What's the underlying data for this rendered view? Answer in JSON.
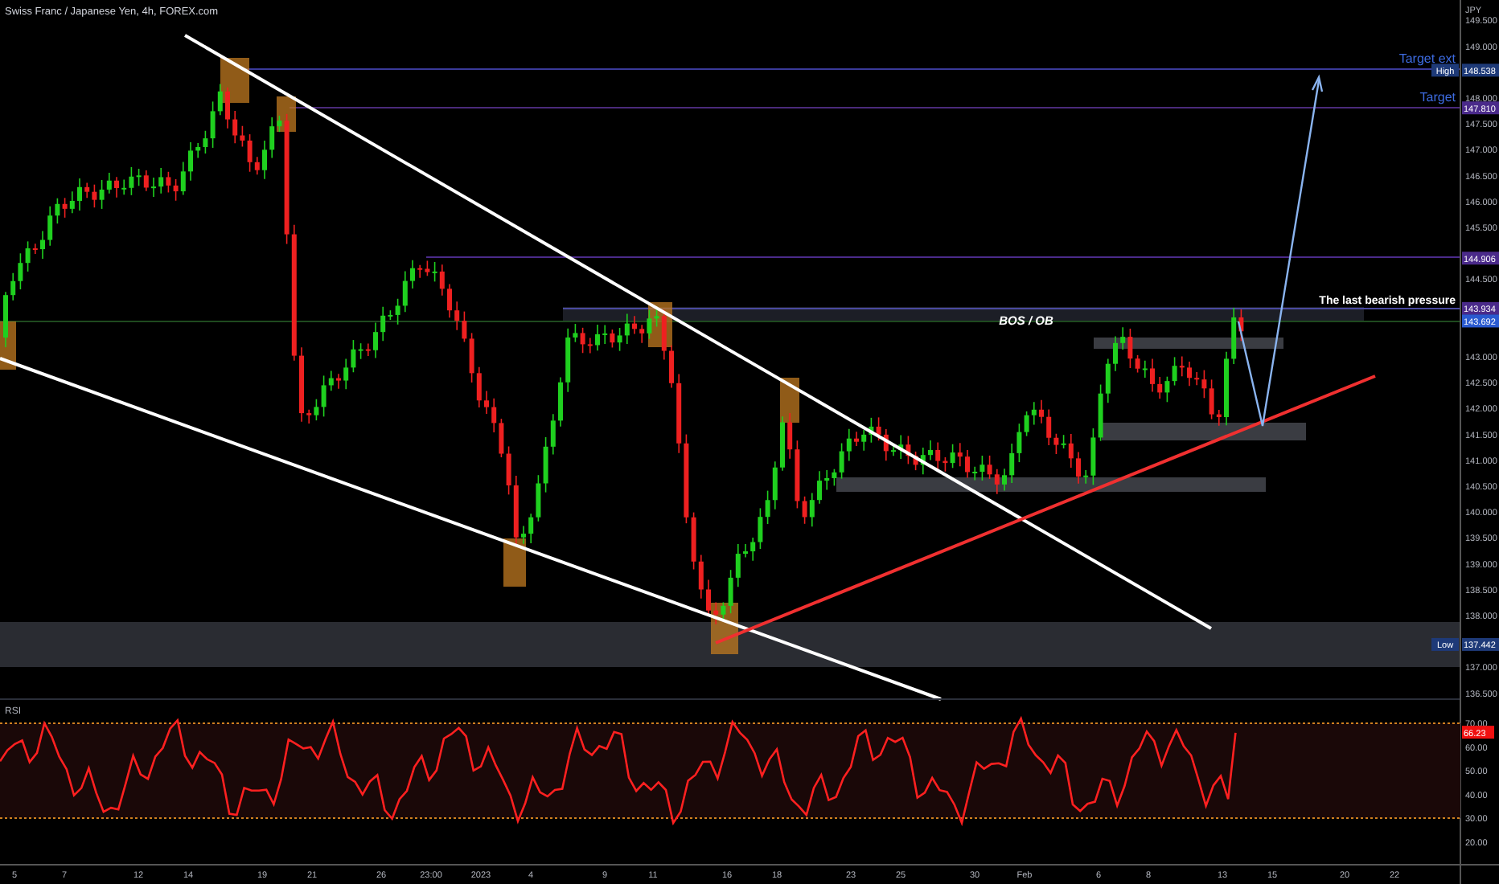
{
  "header": {
    "title": "Swiss Franc / Japanese Yen, 4h, FOREX.com"
  },
  "annotations": [
    {
      "kind": "target",
      "text": "Target ext"
    },
    {
      "kind": "target",
      "text": "Target"
    },
    {
      "kind": "note",
      "text": "The last bearish pressure"
    },
    {
      "kind": "zone",
      "text": "BOS / OB"
    }
  ],
  "price_axis": {
    "currency": "JPY",
    "ticks": [
      "149.500",
      "149.000",
      "148.000",
      "147.500",
      "147.000",
      "146.500",
      "146.000",
      "145.500",
      "144.500",
      "143.000",
      "142.500",
      "142.000",
      "141.500",
      "141.000",
      "140.500",
      "140.000",
      "139.500",
      "139.000",
      "138.500",
      "138.000",
      "137.000",
      "136.500"
    ],
    "badges": [
      {
        "kind": "high",
        "label": "High",
        "value": "148.538"
      },
      {
        "kind": "line",
        "value": "147.810"
      },
      {
        "kind": "line",
        "value": "144.906"
      },
      {
        "kind": "line",
        "value": "143.934"
      },
      {
        "kind": "last",
        "value": "143.692"
      },
      {
        "kind": "low",
        "label": "Low",
        "value": "137.442"
      }
    ]
  },
  "rsi": {
    "title": "RSI",
    "ticks": [
      "70.00",
      "60.00",
      "50.00",
      "40.00",
      "30.00",
      "20.00"
    ],
    "badge": "66.23"
  },
  "time_axis": {
    "labels": [
      "5",
      "7",
      "12",
      "14",
      "19",
      "21",
      "26",
      "23:00",
      "2023",
      "4",
      "9",
      "11",
      "16",
      "18",
      "23",
      "25",
      "30",
      "Feb",
      "6",
      "8",
      "13",
      "15",
      "20",
      "22"
    ]
  }
}
